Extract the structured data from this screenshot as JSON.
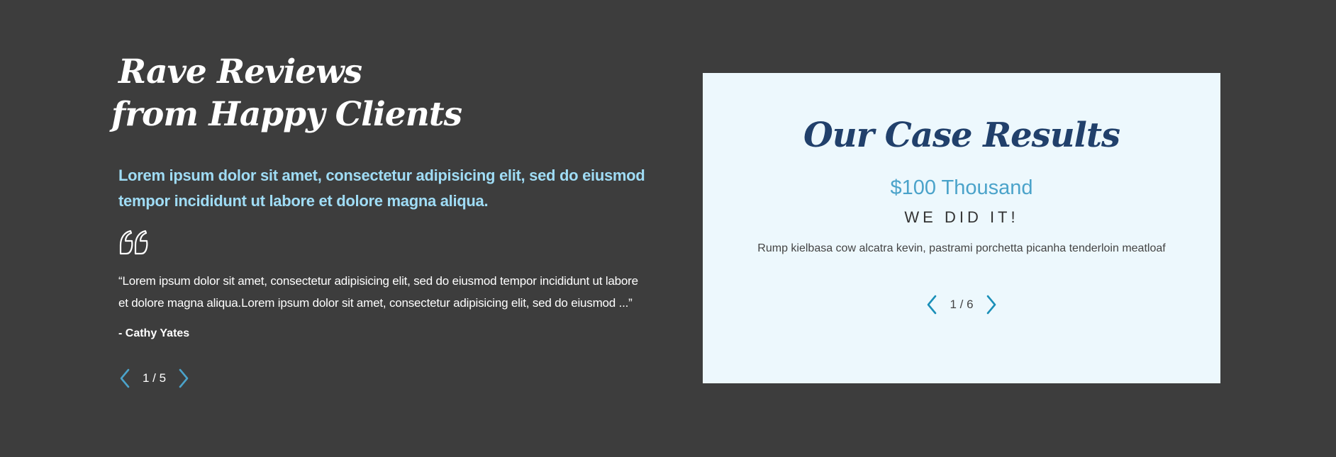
{
  "reviews": {
    "heading_line1": "Rave Reviews",
    "heading_line2": "from Happy Clients",
    "intro": "Lorem ipsum dolor sit amet, consectetur adipisicing elit, sed do eiusmod tempor incididunt ut labore et dolore magna aliqua.",
    "quote": "“Lorem ipsum dolor sit amet, consectetur adipisicing elit, sed do eiusmod tempor incididunt ut labore et dolore magna aliqua.Lorem ipsum dolor sit amet, consectetur adipisicing elit, sed do eiusmod ...”",
    "author": "- Cathy Yates",
    "pager": "1 / 5",
    "quote_icon": "quote-icon",
    "accent_color": "#4ba3ca",
    "intro_color": "#9fdcf5"
  },
  "case_results": {
    "title": "Our Case Results",
    "amount": "$100 Thousand",
    "subtitle": "WE DID IT!",
    "description": "Rump kielbasa cow alcatra kevin, pastrami porchetta picanha tenderloin meatloaf",
    "pager": "1 / 6",
    "title_color": "#21406b",
    "arrow_color": "#1a8fb8",
    "background_color": "#edf8fd"
  },
  "page": {
    "background_color": "#3d3d3d"
  }
}
